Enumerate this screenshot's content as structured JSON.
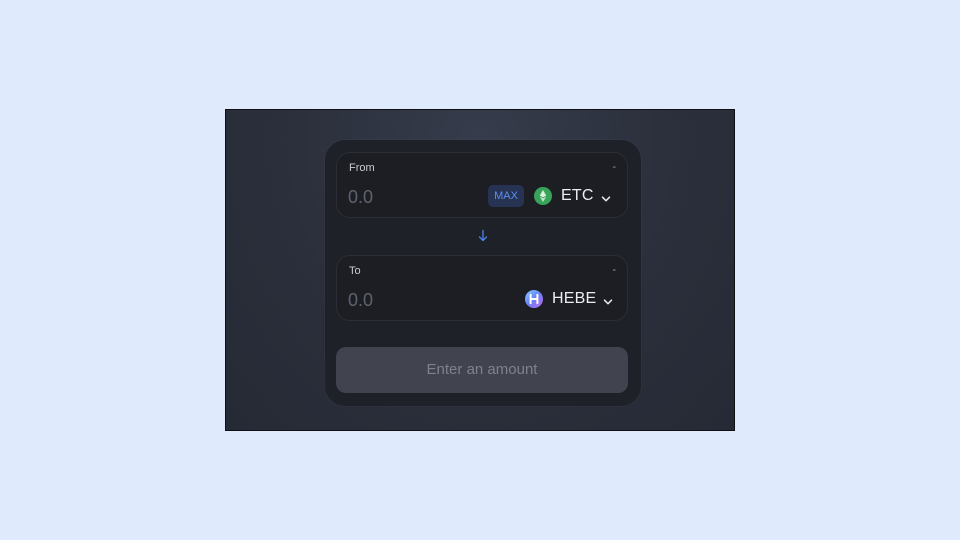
{
  "from": {
    "label": "From",
    "balance": "-",
    "amount_placeholder": "0.0",
    "max_label": "MAX",
    "token": {
      "symbol": "ETC",
      "icon": "etc-token-icon",
      "color": "#3aa35a"
    }
  },
  "swap": {
    "icon": "arrow-down-icon",
    "color": "#4c82ee"
  },
  "to": {
    "label": "To",
    "balance": "-",
    "amount_placeholder": "0.0",
    "token": {
      "symbol": "HEBE",
      "icon": "hebe-token-icon",
      "color": "#5f7ff5"
    }
  },
  "submit": {
    "label": "Enter an amount"
  }
}
